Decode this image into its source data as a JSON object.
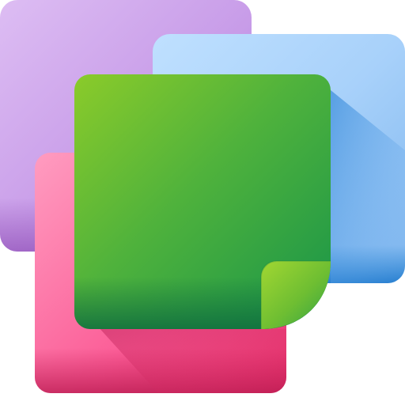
{
  "icon": {
    "name": "sticky-notes-icon",
    "notes": [
      {
        "name": "purple-note",
        "color_top": "#D5B2EE",
        "color_bottom": "#A76ACB"
      },
      {
        "name": "blue-note",
        "color_top": "#B9DDFF",
        "color_bottom": "#4F9BE3"
      },
      {
        "name": "pink-note",
        "color_top": "#FF8FB6",
        "color_bottom": "#E33469"
      },
      {
        "name": "green-note",
        "color_top": "#86C82A",
        "color_bottom": "#15914A"
      }
    ]
  }
}
